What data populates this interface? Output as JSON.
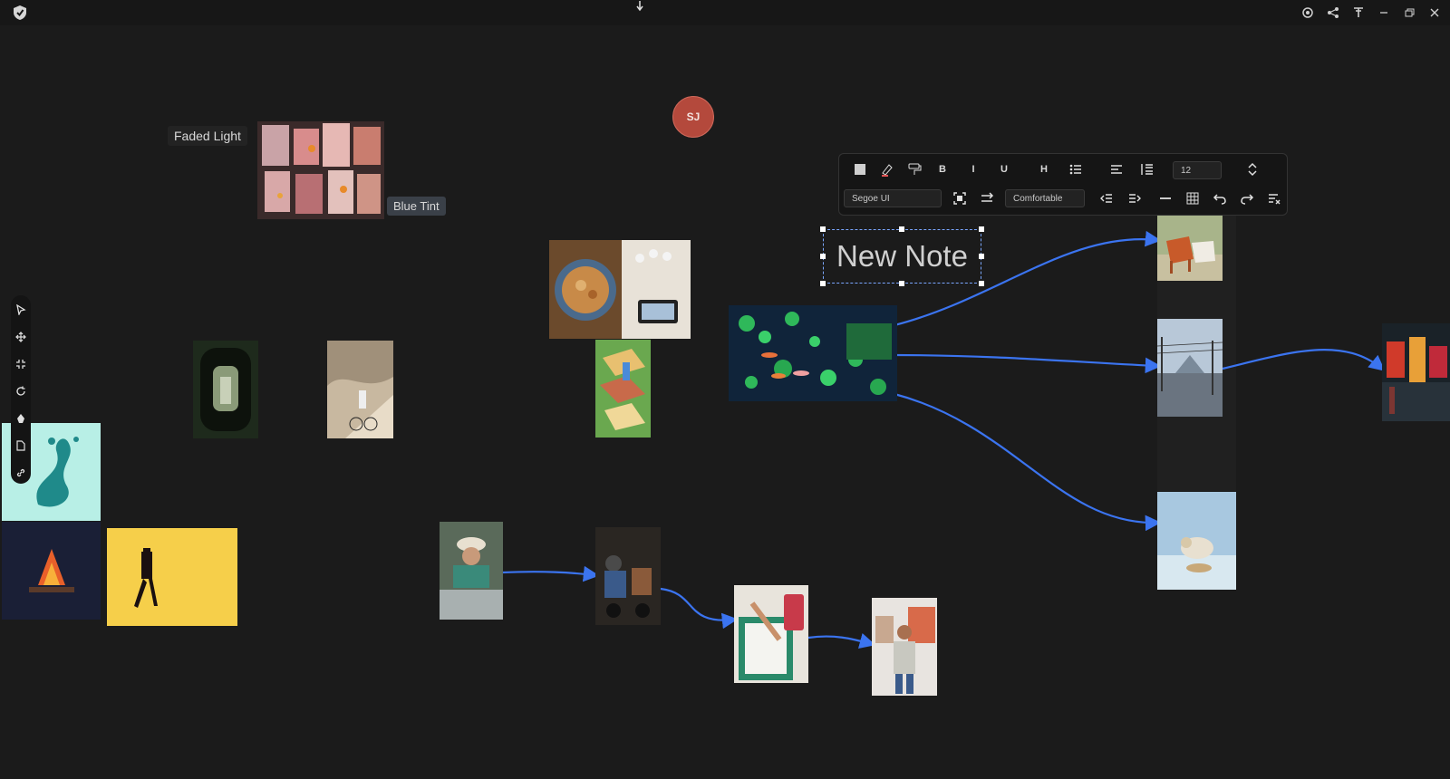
{
  "titlebar": {
    "icons": [
      "shield-logo-icon",
      "down-arrow-icon",
      "target-icon",
      "share-icon",
      "pin-icon",
      "minimize-icon",
      "restore-icon",
      "close-icon"
    ]
  },
  "avatar": {
    "initials": "SJ",
    "color": "#b4493c"
  },
  "labels": {
    "faded_light": "Faded Light",
    "blue_tint": "Blue Tint"
  },
  "note": {
    "text": "New Note"
  },
  "toolbar": {
    "font_name": "Segoe UI",
    "font_size": "12",
    "spacing": "Comfortable",
    "bold": "B",
    "italic": "I",
    "underline": "U",
    "heading": "H"
  },
  "colors": {
    "edge": "#3b74f0",
    "background": "#1b1b1b",
    "accent": "#7aa6ff"
  },
  "left_toolbar": [
    "select-icon",
    "move-icon",
    "fit-icon",
    "rotate-icon",
    "shape-icon",
    "file-icon",
    "link-icon"
  ]
}
